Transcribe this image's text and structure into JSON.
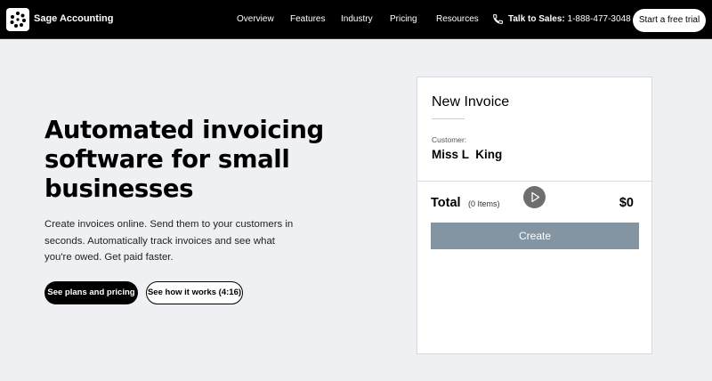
{
  "nav": {
    "brand": "Sage Accounting",
    "links": [
      "Overview",
      "Features",
      "Industry",
      "Pricing",
      "Resources"
    ],
    "sales_label": "Talk to Sales:",
    "sales_phone": "1-888-477-3048",
    "trial_button": "Start a free trial"
  },
  "hero": {
    "headline": "Automated invoicing software for small businesses",
    "subtext": "Create invoices online. Send them to your customers in seconds. Automatically track invoices and see what you're owed. Get paid faster.",
    "primary_button": "See plans and pricing",
    "secondary_button": "See how it works (4:16)"
  },
  "invoice": {
    "title": "New Invoice",
    "customer_label": "Customer:",
    "customer_name": "Miss L  King",
    "total_label": "Total",
    "items_count": "(0 Items)",
    "total_value": "$0",
    "create_button": "Create"
  },
  "icons": {
    "logo": "sage-dots-logo-icon",
    "phone": "phone-icon",
    "play": "play-icon"
  },
  "colors": {
    "nav_bg": "#000000",
    "page_bg": "#eef0f3",
    "create_button_bg": "#8395a3",
    "play_button_bg": "#6e6e6e"
  }
}
